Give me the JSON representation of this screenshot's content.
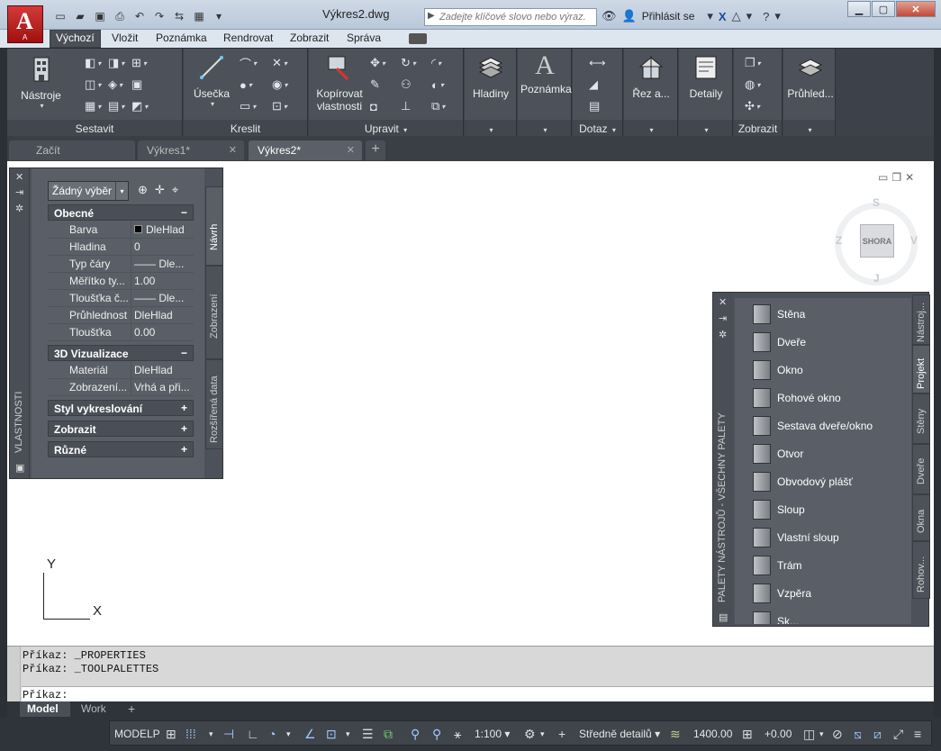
{
  "title": {
    "document": "Výkres2.dwg",
    "app_letter": "A",
    "app_sub": "A"
  },
  "search": {
    "placeholder": "Zadejte klíčové slovo nebo výraz."
  },
  "signin": {
    "label": "Přihlásit se"
  },
  "ribbon_tabs": [
    "Výchozí",
    "Vložit",
    "Poznámka",
    "Rendrovat",
    "Zobrazit",
    "Správa"
  ],
  "ribbon": {
    "panels": {
      "sestavit": "Sestavit",
      "kreslit": "Kreslit",
      "upravit": "Upravit",
      "dotaz": "Dotaz",
      "zobrazit": "Zobrazit"
    },
    "buttons": {
      "nastroje": "Nástroje",
      "usecka": "Úsečka",
      "kopirovat1": "Kopírovat",
      "kopirovat2": "vlastnosti",
      "hladiny": "Hladiny",
      "poznamka": "Poznámka",
      "rez": "Řez a...",
      "detaily": "Detaily",
      "pruhled": "Průhled..."
    }
  },
  "doc_tabs": [
    "Začít",
    "Výkres1*",
    "Výkres2*"
  ],
  "properties": {
    "palette_title": "VLASTNOSTI",
    "selection": "Žádný výběr",
    "sections": {
      "obecne": "Obecné",
      "viz3d": "3D Vizualizace",
      "styl": "Styl vykreslování",
      "zobrazit": "Zobrazit",
      "ruzne": "Různé"
    },
    "general_rows": [
      {
        "key": "Barva",
        "value": "DleHlad"
      },
      {
        "key": "Hladina",
        "value": "0"
      },
      {
        "key": "Typ čáry",
        "value": "—— Dle..."
      },
      {
        "key": "Měřítko ty...",
        "value": "1.00"
      },
      {
        "key": "Tloušťka č...",
        "value": "—— Dle..."
      },
      {
        "key": "Průhlednost",
        "value": "DleHlad"
      },
      {
        "key": "Tloušťka",
        "value": "0.00"
      }
    ],
    "viz_rows": [
      {
        "key": "Materiál",
        "value": "DleHlad"
      },
      {
        "key": "Zobrazení...",
        "value": "Vrhá a při..."
      }
    ],
    "side_tabs": [
      "Návrh",
      "Zobrazení",
      "Rozšířená data"
    ]
  },
  "viewcube": {
    "face": "SHORA",
    "north": "S",
    "south": "J",
    "east": "V",
    "west": "Z"
  },
  "tool_palette": {
    "title": "PALETY NÁSTROJŮ - VŠECHNY PALETY",
    "items": [
      "Stěna",
      "Dveře",
      "Okno",
      "Rohové okno",
      "Sestava dveře/okno",
      "Otvor",
      "Obvodový plášť",
      "Sloup",
      "Vlastní sloup",
      "Trám",
      "Vzpěra",
      "Sk..."
    ],
    "tabs": [
      "Nástroj...",
      "Projekt",
      "Stěny",
      "Dveře",
      "Okna",
      "Rohov..."
    ]
  },
  "ucs": {
    "y": "Y",
    "x": "X"
  },
  "command": {
    "history": [
      "Příkaz: _PROPERTIES",
      "Příkaz: _TOOLPALETTES"
    ],
    "prompt": "Příkaz:"
  },
  "layout_tabs": [
    "Model",
    "Work"
  ],
  "statusbar": {
    "space": "MODELP",
    "scale": "1:100",
    "detail": "Středně detailů",
    "elevation": "1400.00",
    "offset": "+0.00"
  }
}
